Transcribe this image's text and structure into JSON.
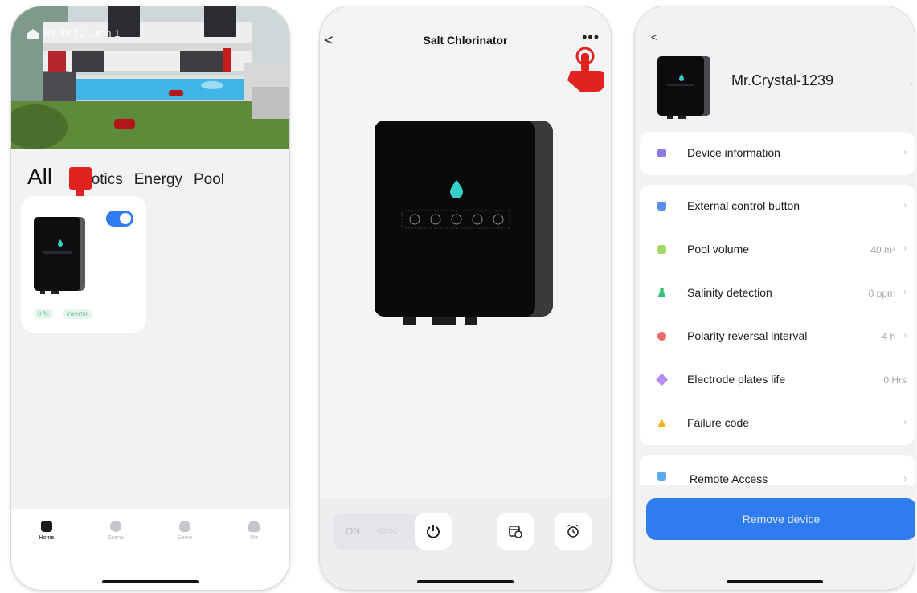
{
  "screen1": {
    "hero_text": "Mr. Pl 71 ...ron 1",
    "tabs": [
      "All",
      "Robotics",
      "Energy",
      "Pool"
    ],
    "tab_robotics_visible": "botics",
    "card": {
      "toggle_on": true,
      "tags": [
        "0 %",
        "inverter"
      ]
    },
    "nav": [
      "Home",
      "Scene",
      "Serve",
      "Me"
    ],
    "active_nav": "Home"
  },
  "screen2": {
    "back": "<",
    "title": "Salt Chlorinator",
    "more": "•••",
    "on_label": "ON",
    "chevrons": "<<<<"
  },
  "screen3": {
    "back": "<",
    "device_name": "Mr.Crystal-1239",
    "group1": [
      {
        "label": "Device information",
        "value": "",
        "icon_color": "#8b7be8"
      }
    ],
    "group2": [
      {
        "label": "External control button",
        "value": "",
        "icon_color": "#5b8def"
      },
      {
        "label": "Pool volume",
        "value": "40 m³",
        "icon_color": "#a6d86a"
      },
      {
        "label": "Salinity detection",
        "value": "0 ppm",
        "icon_color": "#39c27a"
      },
      {
        "label": "Polarity reversal interval",
        "value": "4 h",
        "icon_color": "#ef6a6a"
      },
      {
        "label": "Electrode plates life",
        "value": "0 Hrs",
        "icon_color": "#b98cf0"
      },
      {
        "label": "Failure code",
        "value": "",
        "icon_color": "#f3b51d"
      }
    ],
    "remote_access": "Remote Access",
    "remove_button": "Remove device"
  },
  "accent": "#2f7bf0",
  "pointer_color": "#e0231e"
}
